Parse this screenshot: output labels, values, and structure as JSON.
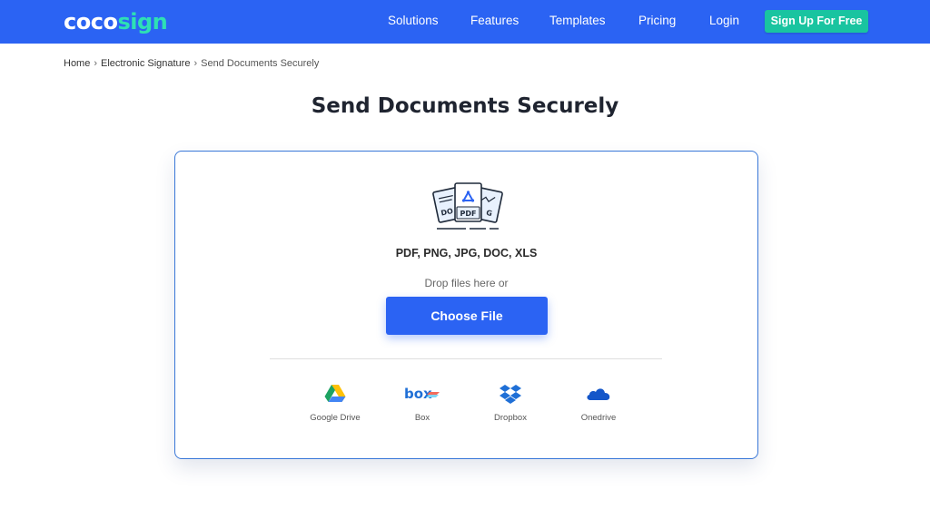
{
  "brand": {
    "part1": "coco",
    "part2": "sign"
  },
  "nav": {
    "items": [
      "Solutions",
      "Features",
      "Templates",
      "Pricing",
      "Login"
    ],
    "signup": "Sign Up For Free"
  },
  "breadcrumb": {
    "home": "Home",
    "section": "Electronic Signature",
    "current": "Send Documents Securely",
    "separator": "›"
  },
  "page": {
    "title": "Send Documents Securely"
  },
  "upload": {
    "icon_label": "PDF",
    "formats": "PDF, PNG, JPG, DOC, XLS",
    "drop_text": "Drop files here or",
    "choose_button": "Choose File",
    "sources": [
      {
        "label": "Google Drive",
        "icon": "google-drive-icon"
      },
      {
        "label": "Box",
        "icon": "box-icon"
      },
      {
        "label": "Dropbox",
        "icon": "dropbox-icon"
      },
      {
        "label": "Onedrive",
        "icon": "onedrive-icon"
      }
    ]
  },
  "colors": {
    "primary": "#2b63f3",
    "accent": "#19c4a0",
    "logo_accent": "#2ee0b4",
    "card_border": "#3a78d8"
  }
}
